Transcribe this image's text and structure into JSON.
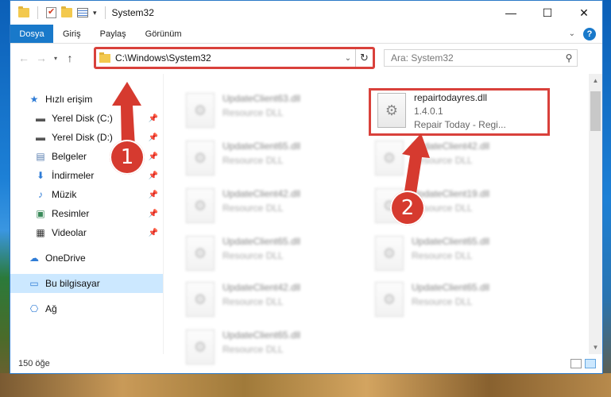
{
  "window": {
    "title": "System32",
    "controls": {
      "minimize": "—",
      "maximize": "☐",
      "close": "✕"
    }
  },
  "ribbon": {
    "file_tab": "Dosya",
    "tabs": [
      "Giriş",
      "Paylaş",
      "Görünüm"
    ]
  },
  "address_bar": {
    "path": "C:\\Windows\\System32",
    "search_placeholder": "Ara: System32"
  },
  "sidebar": {
    "quick_access": "Hızlı erişim",
    "items": [
      {
        "label": "Yerel Disk (C:)",
        "icon": "drive-icon"
      },
      {
        "label": "Yerel Disk (D:)",
        "icon": "drive-icon"
      },
      {
        "label": "Belgeler",
        "icon": "documents-icon"
      },
      {
        "label": "İndirmeler",
        "icon": "download-icon"
      },
      {
        "label": "Müzik",
        "icon": "music-icon"
      },
      {
        "label": "Resimler",
        "icon": "pictures-icon"
      },
      {
        "label": "Videolar",
        "icon": "videos-icon"
      }
    ],
    "onedrive": "OneDrive",
    "this_pc": "Bu bilgisayar",
    "network": "Ağ"
  },
  "files": {
    "highlighted": {
      "name": "repairtodayres.dll",
      "version": "1.4.0.1",
      "description": "Repair Today - Regi..."
    },
    "left_column": [
      {
        "name": "UpdateClient63.dll",
        "type": "Resource DLL"
      },
      {
        "name": "UpdateClient65.dll",
        "type": "Resource DLL"
      },
      {
        "name": "UpdateClient42.dll",
        "type": "Resource DLL"
      },
      {
        "name": "UpdateClient65.dll",
        "type": "Resource DLL"
      },
      {
        "name": "UpdateClient42.dll",
        "type": "Resource DLL"
      },
      {
        "name": "UpdateClient65.dll",
        "type": "Resource DLL"
      }
    ],
    "right_column": [
      {
        "name": "UpdateClient42.dll",
        "type": "Resource DLL"
      },
      {
        "name": "UpdateClient19.dll",
        "type": "Resource DLL"
      },
      {
        "name": "UpdateClient65.dll",
        "type": "Resource DLL"
      },
      {
        "name": "UpdateClient65.dll",
        "type": "Resource DLL"
      }
    ]
  },
  "status": {
    "item_count": "150 öğe"
  },
  "annotations": {
    "badge1": "1",
    "badge2": "2",
    "accent": "#d63a2f"
  }
}
